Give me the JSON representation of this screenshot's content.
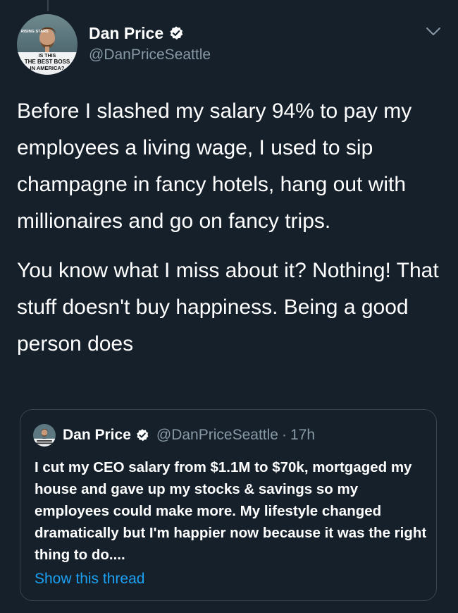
{
  "tweet": {
    "author": {
      "display_name": "Dan Price",
      "handle": "@DanPriceSeattle",
      "avatar_icon": "magazine-cover-avatar",
      "avatar_text_lines": [
        "IS THIS",
        "THE BEST BOSS",
        "IN AMERICA?"
      ],
      "avatar_tag": "RISING STARS",
      "verified": true
    },
    "paragraphs": [
      "Before I slashed my salary 94% to pay my employees a living wage, I used to sip champagne in fancy hotels, hang out with millionaires and go on fancy trips.",
      "You know what I miss about it? Nothing! That stuff doesn't buy happiness. Being a good person does"
    ],
    "quoted_tweet": {
      "display_name": "Dan Price",
      "handle": "@DanPriceSeattle",
      "separator": "·",
      "time": "17h",
      "text": "I cut my CEO salary from $1.1M to $70k, mortgaged my house and gave up my stocks & savings so my employees could make more. My lifestyle changed dramatically but I'm happier now because it was the right thing to do....",
      "show_thread_label": "Show this thread"
    }
  },
  "colors": {
    "background": "#15202b",
    "primary_text": "#ffffff",
    "secondary_text": "#8899a6",
    "link": "#1da1f2",
    "border": "#38444d"
  },
  "icons": {
    "verified": "verified-badge-icon",
    "menu": "chevron-down-icon"
  }
}
